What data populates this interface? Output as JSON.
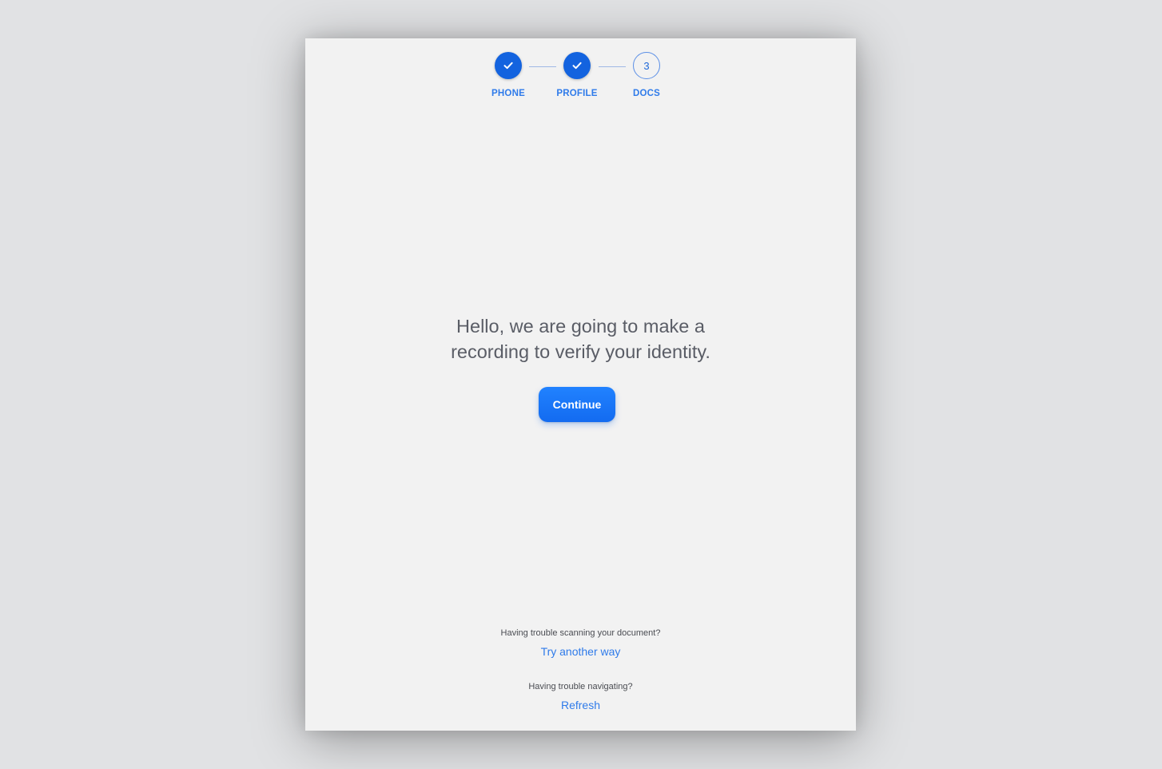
{
  "stepper": {
    "steps": [
      {
        "label": "PHONE",
        "state": "done",
        "icon": "check-icon"
      },
      {
        "label": "PROFILE",
        "state": "done",
        "icon": "check-icon"
      },
      {
        "label": "DOCS",
        "state": "current",
        "number": "3"
      }
    ]
  },
  "main": {
    "headline_line1": "Hello, we are going to make a",
    "headline_line2": "recording to verify your identity.",
    "continue_label": "Continue"
  },
  "help": {
    "scan_question": "Having trouble scanning your document?",
    "scan_link": "Try another way",
    "nav_question": "Having trouble navigating?",
    "nav_link": "Refresh"
  },
  "colors": {
    "accent": "#1363df",
    "link": "#2f7bea",
    "headline": "#5a5d66",
    "card_bg": "#f2f2f2",
    "page_bg": "#e1e2e4"
  }
}
